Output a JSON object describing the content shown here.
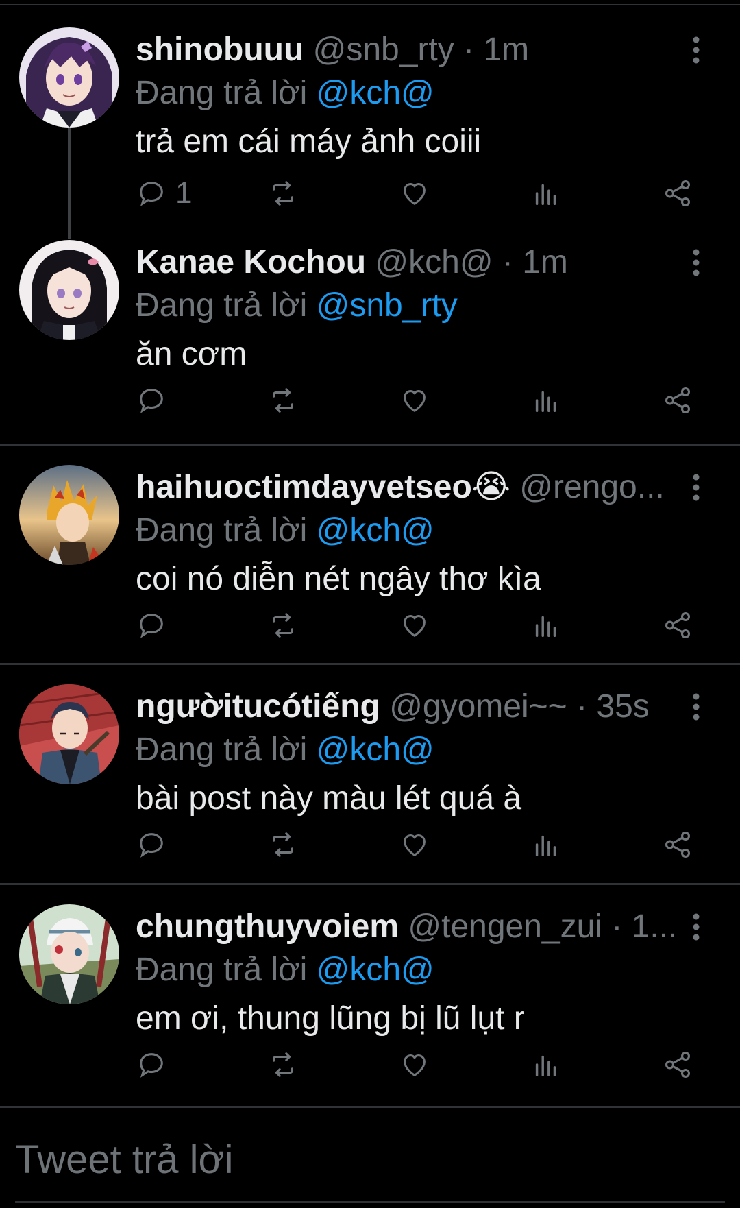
{
  "colors": {
    "background": "#000000",
    "text": "#e7e9ea",
    "secondary": "#71767b",
    "mention": "#1d9bf0",
    "divider": "#2f3336"
  },
  "icons": {
    "reply": "reply-icon",
    "retweet": "retweet-icon",
    "like": "heart-icon",
    "views": "bar-chart-icon",
    "share": "share-icon",
    "more": "more-vertical-icon"
  },
  "tweets": [
    {
      "name": "shinobuuu",
      "handle": "@snb_rty",
      "dot": "·",
      "time": "1m",
      "replying_prefix": "Đang trả lời",
      "replying_to": "@kch@",
      "text": "trả em cái máy ảnh coiii",
      "reply_count": "1"
    },
    {
      "name": "Kanae Kochou",
      "handle": "@kch@",
      "dot": "·",
      "time": "1m",
      "replying_prefix": "Đang trả lời",
      "replying_to": "@snb_rty",
      "text": "ăn cơm",
      "reply_count": ""
    },
    {
      "name": "haihuoctimdayvetseo😭",
      "handle": "@rengo...",
      "dot": "",
      "time": "",
      "replying_prefix": "Đang trả lời",
      "replying_to": "@kch@",
      "text": "coi nó diễn nét ngây thơ kìa",
      "reply_count": ""
    },
    {
      "name": "ngườitucótiếng",
      "handle": "@gyomei~~",
      "dot": "·",
      "time": "35s",
      "replying_prefix": "Đang trả lời",
      "replying_to": "@kch@",
      "text": "bài post này màu lét quá à",
      "reply_count": ""
    },
    {
      "name": "chungthuyvoiem",
      "handle": "@tengen_zui",
      "dot": "·",
      "time": "1...",
      "replying_prefix": "Đang trả lời",
      "replying_to": "@kch@",
      "text": "em ơi, thung lũng bị lũ lụt r",
      "reply_count": ""
    }
  ],
  "reply_box": {
    "placeholder": "Tweet trả lời"
  }
}
